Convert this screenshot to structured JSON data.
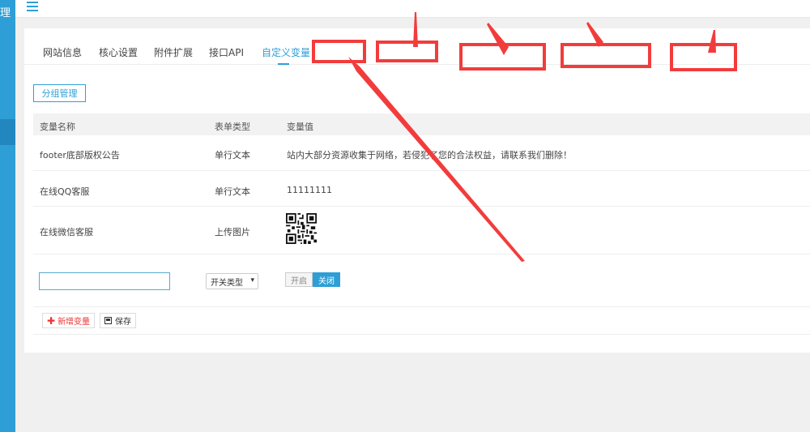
{
  "sidebar": {
    "logo_text": "理"
  },
  "tabs": [
    {
      "label": "网站信息"
    },
    {
      "label": "核心设置"
    },
    {
      "label": "附件扩展"
    },
    {
      "label": "接口API"
    },
    {
      "label": "自定义变量"
    }
  ],
  "group_button": {
    "label": "分组管理"
  },
  "table": {
    "headers": [
      "变量名称",
      "表单类型",
      "变量值"
    ],
    "rows": [
      {
        "name": "footer底部版权公告",
        "type": "单行文本",
        "value": "站内大部分资源收集于网络，若侵犯了您的合法权益，请联系我们删除！"
      },
      {
        "name": "在线QQ客服",
        "type": "单行文本",
        "value": "11111111"
      },
      {
        "name": "在线微信客服",
        "type": "上传图片",
        "value": ""
      }
    ]
  },
  "new_row": {
    "name_value": "",
    "type_select": "开关类型",
    "switch_on": "开启",
    "switch_off": "关闭"
  },
  "actions": {
    "add_label": "新增变量",
    "save_label": "保存"
  },
  "colors": {
    "accent": "#2e9fd6",
    "annotation": "#f23c3c",
    "danger": "#e33333"
  }
}
